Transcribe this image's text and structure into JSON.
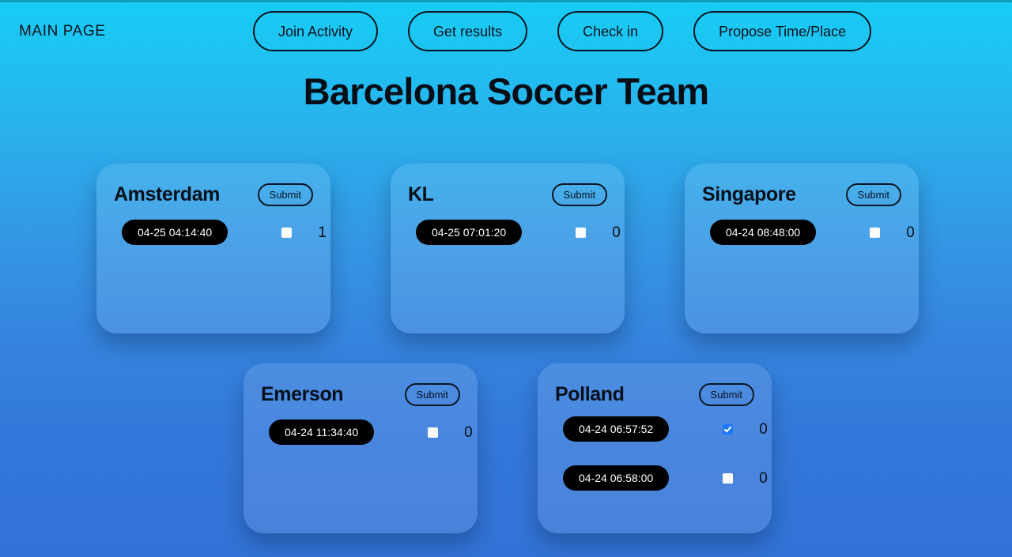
{
  "header": {
    "brand": "MAIN PAGE",
    "nav": [
      {
        "label": "Join Activity"
      },
      {
        "label": "Get results"
      },
      {
        "label": "Check in"
      },
      {
        "label": "Propose Time/Place"
      }
    ]
  },
  "page_title": "Barcelona Soccer Team",
  "colors": {
    "gradient_top": "#16CDF5",
    "gradient_bottom": "#3272D6",
    "card_fill": "rgba(255,255,255,0.115)",
    "pill_bg": "#000000",
    "pill_text": "#FFFFFF",
    "checkbox_checked": "#2176FF",
    "checkbox_unchecked": "#FDFDFD",
    "text": "#07111C"
  },
  "cards": [
    {
      "title": "Amsterdam",
      "submit_label": "Submit",
      "slots": [
        {
          "time": "04-25 04:14:40",
          "checked": false,
          "count": "1"
        }
      ]
    },
    {
      "title": "KL",
      "submit_label": "Submit",
      "slots": [
        {
          "time": "04-25 07:01:20",
          "checked": false,
          "count": "0"
        }
      ]
    },
    {
      "title": "Singapore",
      "submit_label": "Submit",
      "slots": [
        {
          "time": "04-24 08:48:00",
          "checked": false,
          "count": "0"
        }
      ]
    },
    {
      "title": "Emerson",
      "submit_label": "Submit",
      "slots": [
        {
          "time": "04-24 11:34:40",
          "checked": false,
          "count": "0"
        }
      ]
    },
    {
      "title": "Polland",
      "submit_label": "Submit",
      "slots": [
        {
          "time": "04-24 06:57:52",
          "checked": true,
          "count": "0"
        },
        {
          "time": "04-24 06:58:00",
          "checked": false,
          "count": "0"
        }
      ]
    }
  ]
}
